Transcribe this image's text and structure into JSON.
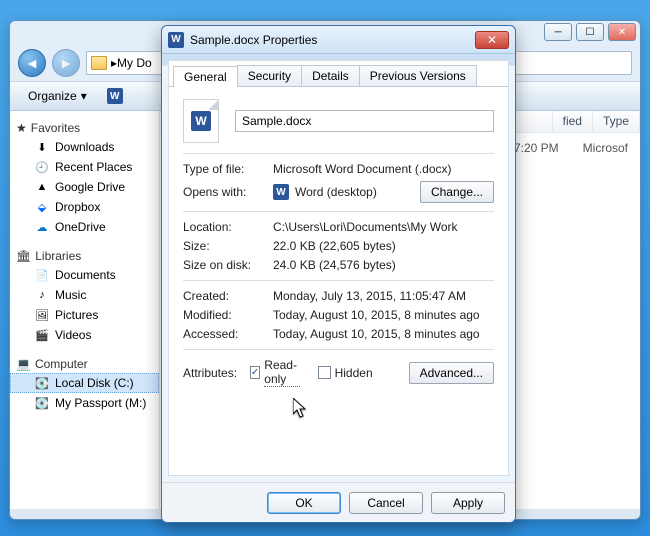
{
  "explorer": {
    "address_text": "My Do",
    "toolbar": {
      "organize": "Organize",
      "open_badge": "W"
    },
    "columns": {
      "modified": "fied",
      "type": "Type"
    },
    "row_cells": {
      "time": "7:20 PM",
      "type": "Microsof"
    },
    "sidebar": {
      "favorites": {
        "label": "Favorites"
      },
      "downloads": "Downloads",
      "recent": "Recent Places",
      "gdrive": "Google Drive",
      "dropbox": "Dropbox",
      "onedrive": "OneDrive",
      "libraries": {
        "label": "Libraries"
      },
      "documents": "Documents",
      "music": "Music",
      "pictures": "Pictures",
      "videos": "Videos",
      "computer": {
        "label": "Computer"
      },
      "cdrive": "Local Disk (C:)",
      "passport": "My Passport (M:)"
    },
    "file": {
      "name": "Sample.docx",
      "sub": "Microsoft W"
    }
  },
  "dialog": {
    "title": "Sample.docx Properties",
    "tabs": {
      "general": "General",
      "security": "Security",
      "details": "Details",
      "previous": "Previous Versions"
    },
    "filename": "Sample.docx",
    "labels": {
      "typeof": "Type of file:",
      "opens": "Opens with:",
      "change": "Change...",
      "location": "Location:",
      "size": "Size:",
      "sizeondisk": "Size on disk:",
      "created": "Created:",
      "modified": "Modified:",
      "accessed": "Accessed:",
      "attributes": "Attributes:",
      "readonly": "Read-only",
      "hidden": "Hidden",
      "advanced": "Advanced..."
    },
    "values": {
      "typeof": "Microsoft Word Document (.docx)",
      "opens": "Word (desktop)",
      "location": "C:\\Users\\Lori\\Documents\\My Work",
      "size": "22.0 KB (22,605 bytes)",
      "sizeondisk": "24.0 KB (24,576 bytes)",
      "created": "Monday, July 13, 2015, 11:05:47 AM",
      "modified": "Today, August 10, 2015, 8 minutes ago",
      "accessed": "Today, August 10, 2015, 8 minutes ago"
    },
    "buttons": {
      "ok": "OK",
      "cancel": "Cancel",
      "apply": "Apply"
    }
  }
}
